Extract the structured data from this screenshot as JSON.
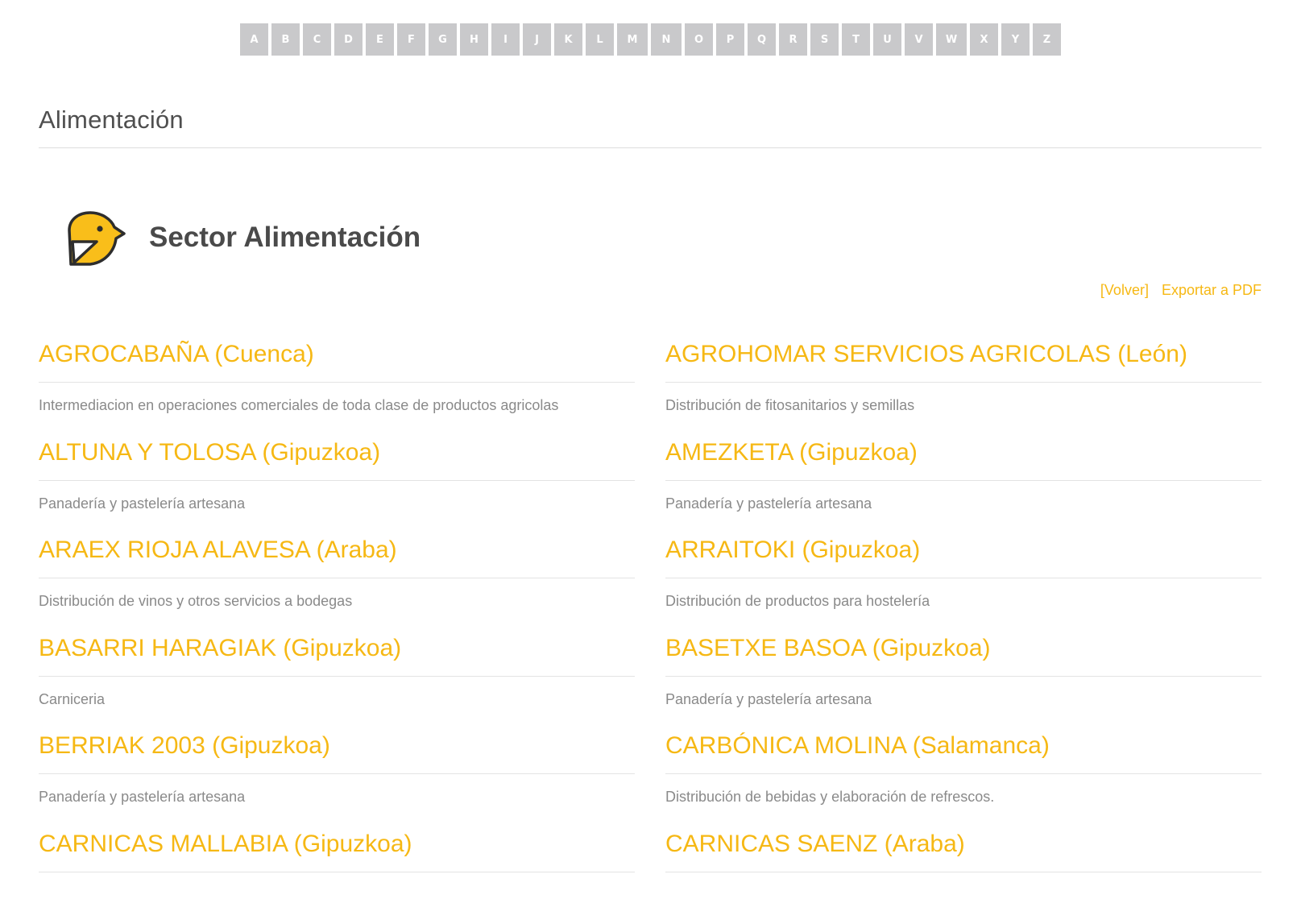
{
  "alphabet": [
    "A",
    "B",
    "C",
    "D",
    "E",
    "F",
    "G",
    "H",
    "I",
    "J",
    "K",
    "L",
    "M",
    "N",
    "O",
    "P",
    "Q",
    "R",
    "S",
    "T",
    "U",
    "V",
    "W",
    "X",
    "Y",
    "Z"
  ],
  "page_title": "Alimentación",
  "sector": {
    "title": "Sector Alimentación",
    "icon": "bird-icon",
    "icon_color": "#f9be1a"
  },
  "links": {
    "back": "[Volver]",
    "export": "Exportar a PDF"
  },
  "accent_color": "#f6b814",
  "companies_left": [
    {
      "name": "AGROCABAÑA (Cuenca)",
      "desc": "Intermediacion en operaciones comerciales de toda clase de productos agricolas"
    },
    {
      "name": "ALTUNA Y TOLOSA (Gipuzkoa)",
      "desc": "Panadería y pastelería artesana"
    },
    {
      "name": "ARAEX RIOJA ALAVESA (Araba)",
      "desc": "Distribución de vinos y otros servicios a bodegas"
    },
    {
      "name": "BASARRI HARAGIAK (Gipuzkoa)",
      "desc": "Carniceria"
    },
    {
      "name": "BERRIAK 2003 (Gipuzkoa)",
      "desc": "Panadería y pastelería artesana"
    },
    {
      "name": "CARNICAS MALLABIA (Gipuzkoa)",
      "desc": ""
    }
  ],
  "companies_right": [
    {
      "name": "AGROHOMAR SERVICIOS AGRICOLAS (León)",
      "desc": "Distribución de fitosanitarios y semillas"
    },
    {
      "name": "AMEZKETA (Gipuzkoa)",
      "desc": "Panadería y pastelería artesana"
    },
    {
      "name": "ARRAITOKI (Gipuzkoa)",
      "desc": "Distribución de productos para hostelería"
    },
    {
      "name": "BASETXE BASOA (Gipuzkoa)",
      "desc": "Panadería y pastelería artesana"
    },
    {
      "name": "CARBÓNICA MOLINA (Salamanca)",
      "desc": "Distribución de bebidas y elaboración de refrescos."
    },
    {
      "name": "CARNICAS SAENZ (Araba)",
      "desc": ""
    }
  ]
}
